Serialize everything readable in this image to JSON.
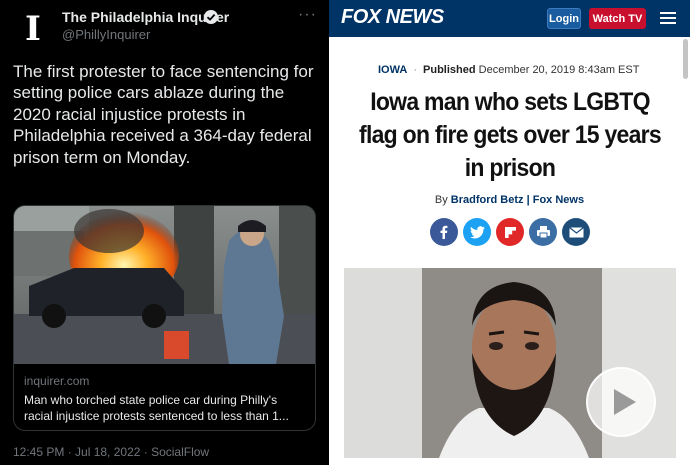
{
  "tweet": {
    "avatar_glyph": "I",
    "account_name": "The Philadelphia Inquirer",
    "handle": "@PhillyInquirer",
    "more_label": "···",
    "text": "The first protester to face sentencing for setting police cars ablaze during the 2020 racial injustice protests in Philadelphia received a 364-day federal prison term on Monday.",
    "card": {
      "domain": "inquirer.com",
      "title": "Man who torched state police car during Philly's racial injustice protests sentenced to less than 1..."
    },
    "meta": "12:45 PM · Jul 18, 2022 · SocialFlow"
  },
  "fox": {
    "logo": "FOX NEWS",
    "login_label": "Login",
    "watch_label": "Watch TV",
    "category": "IOWA",
    "published_label": "Published",
    "published_date": "December 20, 2019 8:43am EST",
    "headline": "Iowa man who sets LGBTQ flag on fire gets over 15 years in prison",
    "byline_prefix": "By",
    "author": "Bradford Betz",
    "byline_sep": "|",
    "source": "Fox News",
    "share": [
      "facebook-icon",
      "twitter-icon",
      "flipboard-icon",
      "print-icon",
      "email-icon"
    ]
  },
  "colors": {
    "fox_navy": "#003366",
    "fox_red": "#c8102e",
    "twitter_bg": "#000000",
    "twitter_text": "#e7e9ea",
    "twitter_muted": "#71767b"
  }
}
